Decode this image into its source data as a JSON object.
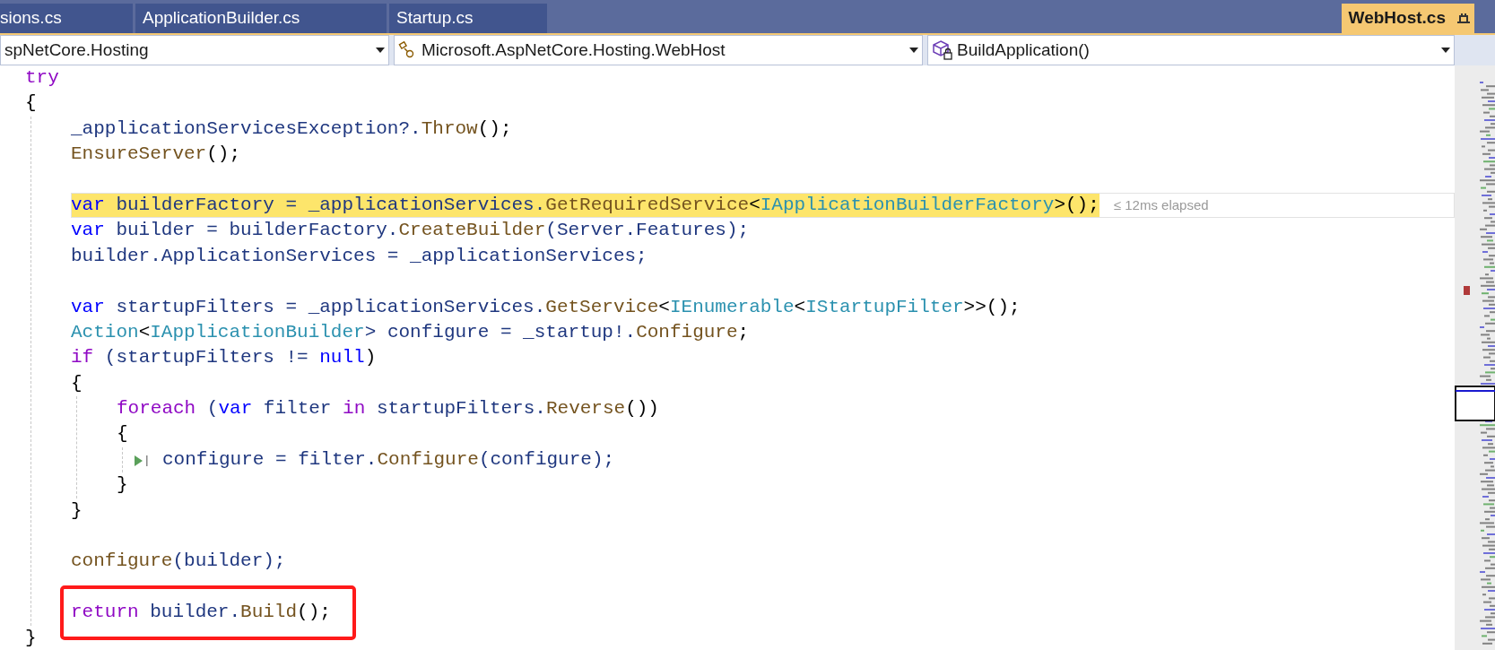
{
  "tabs": [
    {
      "label": "sions.cs",
      "selected": false
    },
    {
      "label": "ApplicationBuilder.cs",
      "selected": false
    },
    {
      "label": "Startup.cs",
      "selected": false
    },
    {
      "label": "WebHost.cs",
      "selected": true
    }
  ],
  "navigation": [
    {
      "kind": "plain",
      "text": "spNetCore.Hosting"
    },
    {
      "kind": "class",
      "text": "Microsoft.AspNetCore.Hosting.WebHost"
    },
    {
      "kind": "method",
      "text": "BuildApplication()"
    }
  ],
  "code_lines": [
    {
      "highlighted": false,
      "boxed": false,
      "tokens": [
        {
          "kind": "control",
          "text": "try"
        }
      ]
    },
    {
      "highlighted": false,
      "boxed": false,
      "tokens": [
        {
          "kind": "punct",
          "text": "{"
        }
      ],
      "children": [
        {
          "highlighted": false,
          "boxed": false,
          "tokens": [
            {
              "kind": "ident",
              "text": "_applicationServicesException?."
            },
            {
              "kind": "method",
              "text": "Throw"
            },
            {
              "kind": "punct",
              "text": "();"
            }
          ]
        },
        {
          "highlighted": false,
          "boxed": false,
          "tokens": [
            {
              "kind": "method",
              "text": "EnsureServer"
            },
            {
              "kind": "punct",
              "text": "();"
            }
          ]
        },
        {
          "highlighted": false,
          "boxed": false
        },
        {
          "highlighted": true,
          "boxed": false,
          "hint": "≤ 12ms elapsed",
          "tokens": [
            {
              "kind": "keyword",
              "text": "var"
            },
            {
              "kind": "ident",
              "text": " builderFactory = _applicationServices."
            },
            {
              "kind": "method",
              "text": "GetRequiredService"
            },
            {
              "kind": "punct",
              "text": "<"
            },
            {
              "kind": "type",
              "text": "IApplicationBuilderFactory"
            },
            {
              "kind": "punct",
              "text": ">();"
            }
          ]
        },
        {
          "highlighted": false,
          "boxed": false,
          "tokens": [
            {
              "kind": "keyword",
              "text": "var"
            },
            {
              "kind": "ident",
              "text": " builder = builderFactory."
            },
            {
              "kind": "method",
              "text": "CreateBuilder"
            },
            {
              "kind": "ident",
              "text": "(Server.Features);"
            }
          ]
        },
        {
          "highlighted": false,
          "boxed": false,
          "tokens": [
            {
              "kind": "ident",
              "text": "builder.ApplicationServices = _applicationServices;"
            }
          ]
        },
        {
          "highlighted": false,
          "boxed": false
        },
        {
          "highlighted": false,
          "boxed": false,
          "tokens": [
            {
              "kind": "keyword",
              "text": "var"
            },
            {
              "kind": "ident",
              "text": " startupFilters = _applicationServices."
            },
            {
              "kind": "method",
              "text": "GetService"
            },
            {
              "kind": "punct",
              "text": "<"
            },
            {
              "kind": "type",
              "text": "IEnumerable"
            },
            {
              "kind": "punct",
              "text": "<"
            },
            {
              "kind": "type",
              "text": "IStartupFilter"
            },
            {
              "kind": "punct",
              "text": ">>();"
            }
          ]
        },
        {
          "highlighted": false,
          "boxed": false,
          "tokens": [
            {
              "kind": "type",
              "text": "Action"
            },
            {
              "kind": "punct",
              "text": "<"
            },
            {
              "kind": "type",
              "text": "IApplicationBuilder"
            },
            {
              "kind": "ident",
              "text": "> configure = _startup!."
            },
            {
              "kind": "method",
              "text": "Configure"
            },
            {
              "kind": "punct",
              "text": ";"
            }
          ]
        },
        {
          "highlighted": false,
          "boxed": false,
          "tokens": [
            {
              "kind": "control",
              "text": "if"
            },
            {
              "kind": "ident",
              "text": " (startupFilters != "
            },
            {
              "kind": "keyword",
              "text": "null"
            },
            {
              "kind": "punct",
              "text": ")"
            }
          ]
        },
        {
          "highlighted": false,
          "boxed": false,
          "tokens": [
            {
              "kind": "punct",
              "text": "{"
            }
          ],
          "children": [
            {
              "highlighted": false,
              "boxed": false,
              "tokens": [
                {
                  "kind": "control",
                  "text": "foreach"
                },
                {
                  "kind": "ident",
                  "text": " ("
                },
                {
                  "kind": "keyword",
                  "text": "var"
                },
                {
                  "kind": "ident",
                  "text": " filter "
                },
                {
                  "kind": "control",
                  "text": "in"
                },
                {
                  "kind": "ident",
                  "text": " startupFilters."
                },
                {
                  "kind": "method",
                  "text": "Reverse"
                },
                {
                  "kind": "punct",
                  "text": "())"
                }
              ]
            },
            {
              "highlighted": false,
              "boxed": false,
              "tokens": [
                {
                  "kind": "punct",
                  "text": "{"
                }
              ],
              "children": [
                {
                  "highlighted": false,
                  "boxed": false,
                  "run_marker": true,
                  "tokens": [
                    {
                      "kind": "ident",
                      "text": "configure = filter."
                    },
                    {
                      "kind": "method",
                      "text": "Configure"
                    },
                    {
                      "kind": "ident",
                      "text": "(configure);"
                    }
                  ]
                }
              ]
            },
            {
              "highlighted": false,
              "boxed": false,
              "tokens": [
                {
                  "kind": "punct",
                  "text": "}"
                }
              ]
            }
          ]
        },
        {
          "highlighted": false,
          "boxed": false,
          "tokens": [
            {
              "kind": "punct",
              "text": "}"
            }
          ]
        },
        {
          "highlighted": false,
          "boxed": false
        },
        {
          "highlighted": false,
          "boxed": false,
          "tokens": [
            {
              "kind": "method",
              "text": "configure"
            },
            {
              "kind": "ident",
              "text": "(builder);"
            }
          ]
        },
        {
          "highlighted": false,
          "boxed": false
        },
        {
          "highlighted": false,
          "boxed": true,
          "tokens": [
            {
              "kind": "control",
              "text": "return"
            },
            {
              "kind": "ident",
              "text": " builder."
            },
            {
              "kind": "method",
              "text": "Build"
            },
            {
              "kind": "punct",
              "text": "();"
            }
          ]
        }
      ]
    },
    {
      "highlighted": false,
      "boxed": false,
      "tokens": [
        {
          "kind": "punct",
          "text": "}"
        }
      ]
    }
  ]
}
